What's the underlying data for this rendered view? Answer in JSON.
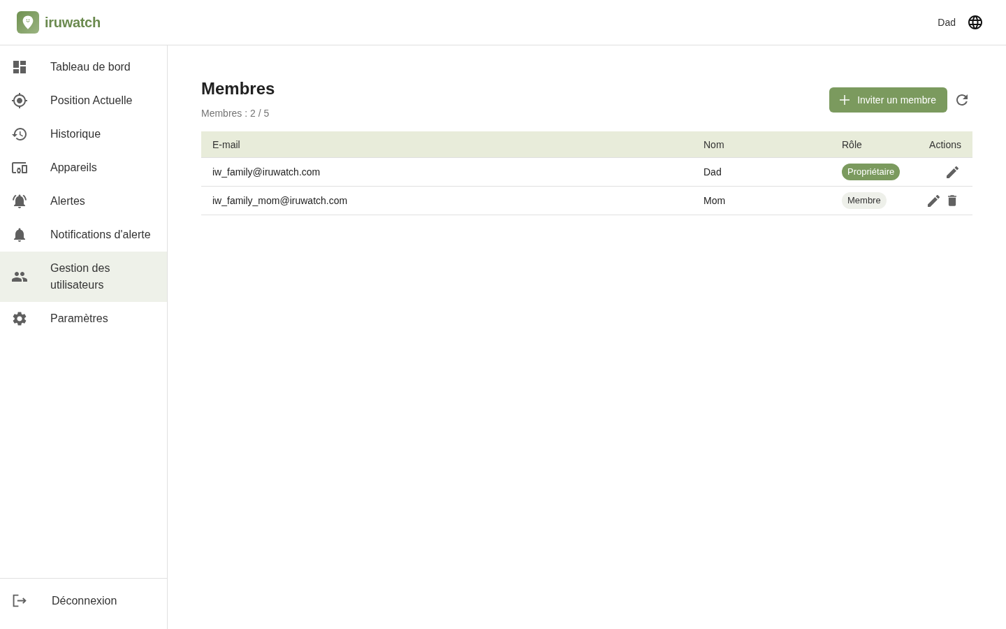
{
  "app": {
    "brand": "iruwatch"
  },
  "header": {
    "user_name": "Dad"
  },
  "sidebar": {
    "items": [
      {
        "label": "Tableau de bord",
        "selected": false
      },
      {
        "label": "Position Actuelle",
        "selected": false
      },
      {
        "label": "Historique",
        "selected": false
      },
      {
        "label": "Appareils",
        "selected": false
      },
      {
        "label": "Alertes",
        "selected": false
      },
      {
        "label": "Notifications d'alerte",
        "selected": false
      },
      {
        "label": "Gestion des utilisateurs",
        "selected": true
      },
      {
        "label": "Paramètres",
        "selected": false
      }
    ],
    "logout": {
      "label": "Déconnexion"
    }
  },
  "page": {
    "title": "Membres",
    "subtitle": "Membres : 2 / 5",
    "invite_button": "Inviter un membre"
  },
  "table": {
    "columns": [
      "E-mail",
      "Nom",
      "Rôle",
      "Actions"
    ],
    "rows": [
      {
        "email": "iw_family@iruwatch.com",
        "name": "Dad",
        "role": {
          "label": "Propriétaire",
          "kind": "owner"
        },
        "actions": [
          {
            "kind": "edit"
          }
        ]
      },
      {
        "email": "iw_family_mom@iruwatch.com",
        "name": "Mom",
        "role": {
          "label": "Membre",
          "kind": "member"
        },
        "actions": [
          {
            "kind": "edit"
          },
          {
            "kind": "delete"
          }
        ]
      }
    ]
  }
}
